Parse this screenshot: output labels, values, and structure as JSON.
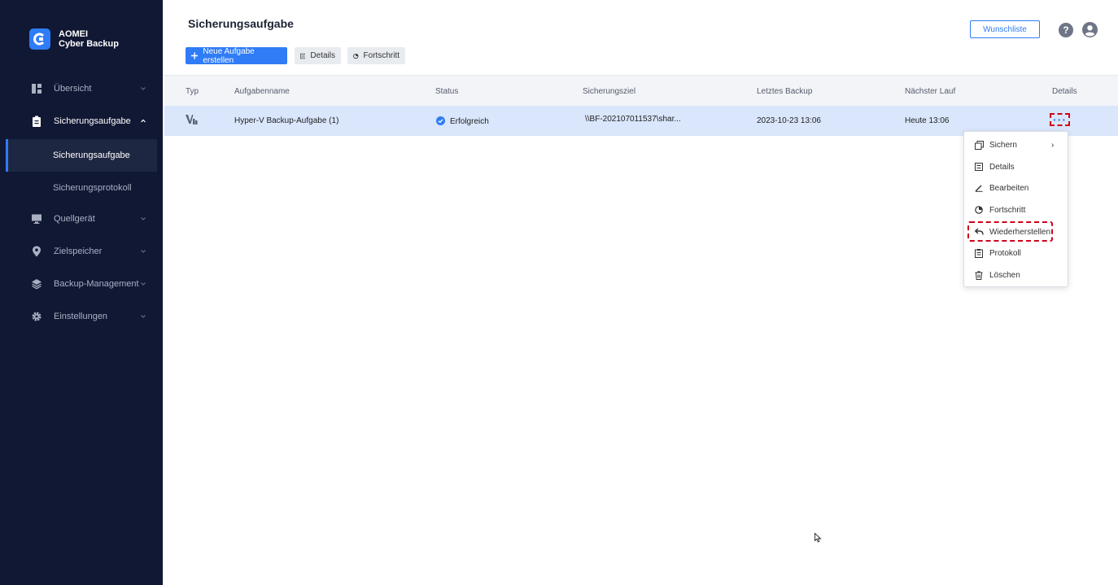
{
  "brand": {
    "name_line1": "AOMEI",
    "name_line2": "Cyber Backup",
    "accent": "#2f7cf6"
  },
  "sidebar": {
    "items": [
      {
        "label": "Übersicht",
        "icon": "dashboard-icon"
      },
      {
        "label": "Sicherungsaufgabe",
        "icon": "clipboard-icon",
        "expanded": true
      },
      {
        "label": "Quellgerät",
        "icon": "monitor-icon"
      },
      {
        "label": "Zielspeicher",
        "icon": "location-pin-icon"
      },
      {
        "label": "Backup-Management",
        "icon": "layers-icon"
      },
      {
        "label": "Einstellungen",
        "icon": "gear-icon"
      }
    ],
    "subitems": [
      {
        "label": "Sicherungsaufgabe",
        "active": true
      },
      {
        "label": "Sicherungsprotokoll"
      }
    ]
  },
  "header": {
    "title": "Sicherungsaufgabe",
    "new_task_label": "Neue Aufgabe erstellen",
    "details_label": "Details",
    "progress_label": "Fortschritt",
    "wishlist_label": "Wunschliste",
    "help_label": "?"
  },
  "table": {
    "columns": [
      "Typ",
      "Aufgabenname",
      "Status",
      "Sicherungsziel",
      "Letztes Backup",
      "Nächster Lauf",
      "Details"
    ],
    "rows": [
      {
        "type_icon": "hyper-v-icon",
        "name": "Hyper-V Backup-Aufgabe (1)",
        "status": "Erfolgreich",
        "target": "\\\\BF-202107011537\\shar...",
        "last_backup": "2023-10-23 13:06",
        "next_run": "Heute 13:06",
        "details": "···"
      }
    ]
  },
  "context_menu": {
    "items": [
      {
        "label": "Sichern",
        "icon": "copy-icon",
        "has_submenu": true,
        "arrow": "›"
      },
      {
        "label": "Details",
        "icon": "details-icon"
      },
      {
        "label": "Bearbeiten",
        "icon": "edit-icon"
      },
      {
        "label": "Fortschritt",
        "icon": "progress-icon"
      },
      {
        "label": "Wiederherstellen",
        "icon": "restore-icon",
        "highlighted": true
      },
      {
        "label": "Protokoll",
        "icon": "log-icon"
      },
      {
        "label": "Löschen",
        "icon": "trash-icon"
      }
    ]
  },
  "colors": {
    "sidebar_bg": "#111834",
    "selected_row": "#d9e6fb",
    "highlight": "#d0021b"
  }
}
